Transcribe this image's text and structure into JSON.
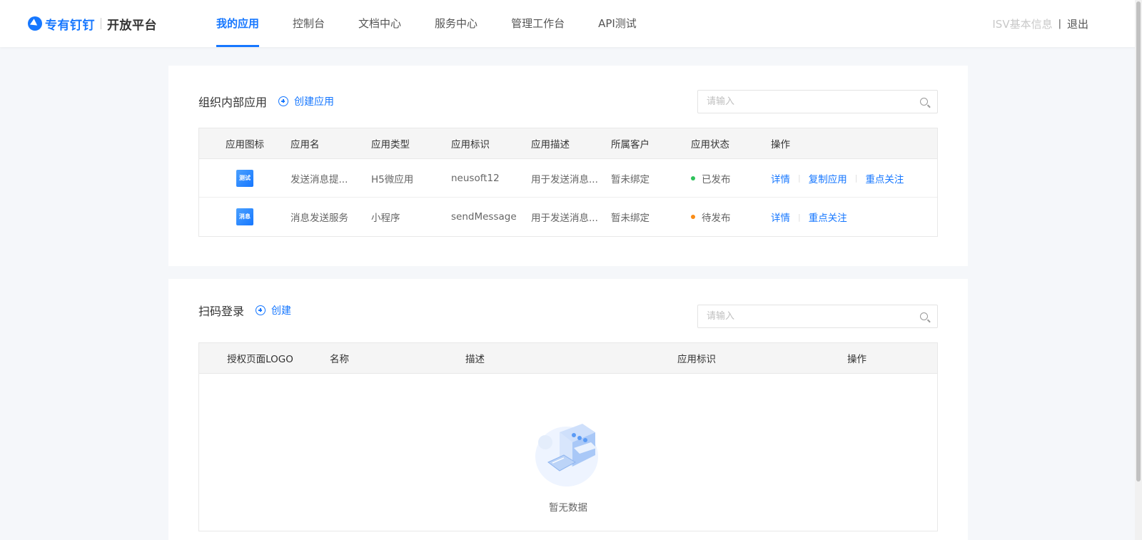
{
  "header": {
    "logo_brand": "专有钉钉",
    "logo_sub": "开放平台",
    "nav": [
      {
        "label": "我的应用",
        "active": true
      },
      {
        "label": "控制台",
        "active": false
      },
      {
        "label": "文档中心",
        "active": false
      },
      {
        "label": "服务中心",
        "active": false
      },
      {
        "label": "管理工作台",
        "active": false
      },
      {
        "label": "API测试",
        "active": false
      }
    ],
    "isv_info": "ISV基本信息",
    "separator": "|",
    "logout": "退出"
  },
  "internal_apps": {
    "title": "组织内部应用",
    "create_label": "创建应用",
    "search_placeholder": "请输入",
    "columns": [
      "应用图标",
      "应用名",
      "应用类型",
      "应用标识",
      "应用描述",
      "所属客户",
      "应用状态",
      "操作"
    ],
    "rows": [
      {
        "icon_text": "测试",
        "name": "发送消息提...",
        "type": "H5微应用",
        "id": "neusoft12",
        "desc": "用于发送消息...",
        "customer": "暂未绑定",
        "status": "已发布",
        "status_color": "#2fc25b",
        "actions": [
          "详情",
          "复制应用",
          "重点关注"
        ]
      },
      {
        "icon_text": "消息",
        "name": "消息发送服务",
        "type": "小程序",
        "id": "sendMessage",
        "desc": "用于发送消息...",
        "customer": "暂未绑定",
        "status": "待发布",
        "status_color": "#fa8c16",
        "actions": [
          "详情",
          "重点关注"
        ]
      }
    ]
  },
  "qr_login": {
    "title": "扫码登录",
    "create_label": "创建",
    "search_placeholder": "请输入",
    "columns": [
      "授权页面LOGO",
      "名称",
      "描述",
      "应用标识",
      "操作"
    ],
    "empty_text": "暂无数据"
  },
  "colors": {
    "accent": "#1677ff",
    "published": "#2fc25b",
    "pending": "#fa8c16"
  }
}
